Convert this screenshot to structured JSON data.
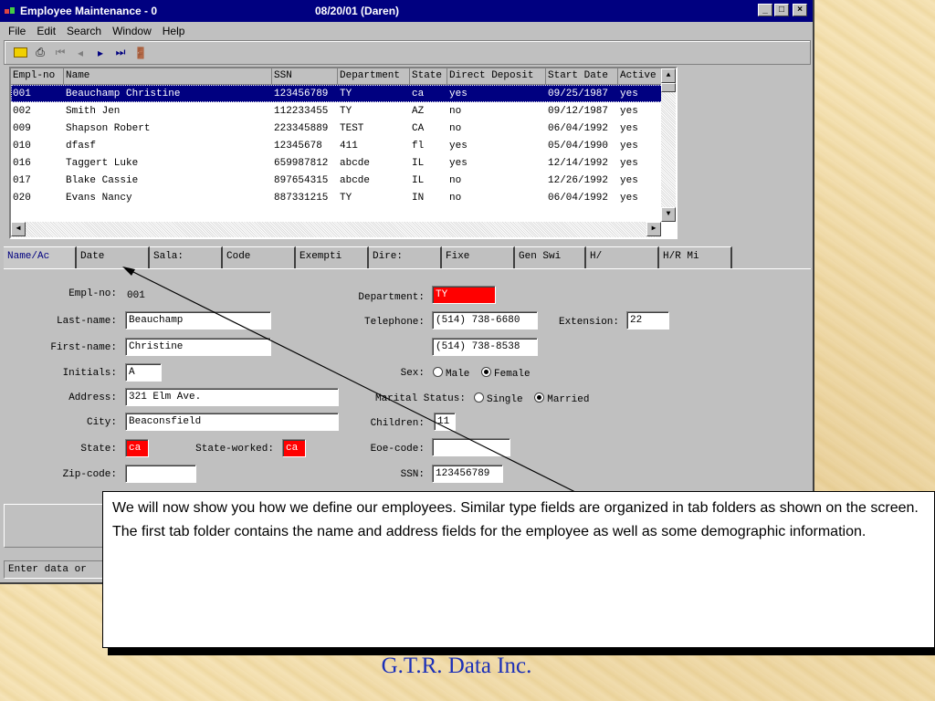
{
  "window": {
    "title": "Employee Maintenance - 0",
    "title_date": "08/20/01 (Daren)",
    "controls": [
      "_",
      "□",
      "×"
    ]
  },
  "menu": [
    "File",
    "Edit",
    "Search",
    "Window",
    "Help"
  ],
  "toolbar": {
    "buttons": [
      "open-folder-icon",
      "print-icon",
      "first-record-icon",
      "previous-record-icon",
      "next-record-icon",
      "last-record-icon",
      "exit-door-icon"
    ]
  },
  "grid": {
    "columns": [
      "Empl-no",
      "Name",
      "SSN",
      "Department",
      "State",
      "Direct Deposit",
      "Start Date",
      "Active"
    ],
    "rows": [
      [
        "001",
        "Beauchamp Christine",
        "123456789",
        "TY",
        "ca",
        "yes",
        "09/25/1987",
        "yes"
      ],
      [
        "002",
        "Smith Jen",
        "112233455",
        "TY",
        "AZ",
        "no",
        "09/12/1987",
        "yes"
      ],
      [
        "009",
        "Shapson Robert",
        "223345889",
        "TEST",
        "CA",
        "no",
        "06/04/1992",
        "yes"
      ],
      [
        "010",
        "dfasf",
        "12345678",
        "411",
        "fl",
        "yes",
        "05/04/1990",
        "yes"
      ],
      [
        "016",
        "Taggert Luke",
        "659987812",
        "abcde",
        "IL",
        "yes",
        "12/14/1992",
        "yes"
      ],
      [
        "017",
        "Blake Cassie",
        "897654315",
        "abcde",
        "IL",
        "no",
        "12/26/1992",
        "yes"
      ],
      [
        "020",
        "Evans Nancy",
        "887331215",
        "TY",
        "IN",
        "no",
        "06/04/1992",
        "yes"
      ]
    ]
  },
  "tabs": [
    "Name/Ac",
    "Date",
    "Sala:",
    "Code",
    "Exempti",
    "Dire:",
    "Fixe",
    "Gen Swi",
    "H/",
    "H/R Mi"
  ],
  "form": {
    "empl_no_label": "Empl-no:",
    "empl_no": "001",
    "last_name_label": "Last-name:",
    "last_name": "Beauchamp",
    "first_name_label": "First-name:",
    "first_name": "Christine",
    "initials_label": "Initials:",
    "initials": "A",
    "address_label": "Address:",
    "address": "321 Elm Ave.",
    "city_label": "City:",
    "city": "Beaconsfield",
    "state_label": "State:",
    "state": "ca",
    "state_worked_label": "State-worked:",
    "state_worked": "ca",
    "zip_label": "Zip-code:",
    "zip": "",
    "department_label": "Department:",
    "department": "TY",
    "telephone_label": "Telephone:",
    "telephone": "(514) 738-6680",
    "extension_label": "Extension:",
    "extension": "22",
    "telephone2": "(514) 738-8538",
    "sex_label": "Sex:",
    "sex_male": "Male",
    "sex_female": "Female",
    "marital_label": "Marital Status:",
    "marital_single": "Single",
    "marital_married": "Married",
    "children_label": "Children:",
    "children": "11",
    "eoe_label": "Eoe-code:",
    "eoe": "",
    "ssn_label": "SSN:",
    "ssn": "123456789"
  },
  "status_text": "Enter data or",
  "callout": {
    "p1": "We will now show you how we define our employees.  Similar type fields are organized in tab folders as shown on the screen.",
    "p2": "The first tab folder contains the name and address fields for the employee as well as some demographic information."
  },
  "brand": "G.T.R. Data Inc.",
  "colors": {
    "title_bar": "#000080",
    "highlight_field": "#ff0000",
    "brand_text": "#1c30b8"
  }
}
